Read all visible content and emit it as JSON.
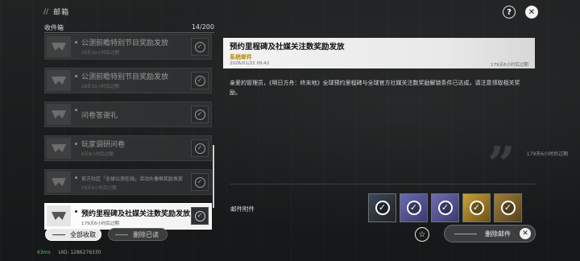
{
  "header": {
    "bars": "//",
    "title": "邮箱"
  },
  "top_icons": {
    "help": "?",
    "close": "✕"
  },
  "inbox": {
    "title": "收件箱",
    "count": "14/200"
  },
  "mails": [
    {
      "title": "公测前瞻特别节目奖励发放",
      "sub": "29天10小时后过期",
      "small": false,
      "dim": true
    },
    {
      "title": "公测前瞻特别节目奖励发放",
      "sub": "29天10小时后过期",
      "small": false,
      "dim": true
    },
    {
      "title": "问卷答谢礼",
      "sub": "",
      "small": false,
      "dim": true
    },
    {
      "title": "玩家调研问卷",
      "sub": "6天9小时后过期",
      "small": false,
      "dim": true
    },
    {
      "title": "官方社区「全球公测在线」活动头像框奖励发放",
      "sub": "29天6小时后过期",
      "small": true,
      "dim": true
    },
    {
      "title": "预约里程碑及社媒关注数奖励发放",
      "sub": "179天6小时后过期",
      "small": false,
      "dim": false,
      "active": true
    }
  ],
  "buttons": {
    "collect_all": "全部收取",
    "delete_read": "删除已读",
    "delete_mail": "删除邮件"
  },
  "detail": {
    "title": "预约里程碑及社媒关注数奖励发放",
    "category": "系统邮件",
    "date": "2026/01/22 09:42",
    "expire": "179天6小时后过期",
    "body": "亲爱的管理员，《明日方舟：终末地》全球预约里程碑与全球官方社媒关注数奖励解锁条件已达成，请注意领取相关奖励。",
    "expire2": "179天6小时后过期",
    "attachments_label": "邮件附件"
  },
  "rewards": [
    {
      "icon": "check-icon"
    },
    {
      "icon": "check-icon"
    },
    {
      "icon": "check-icon"
    },
    {
      "icon": "check-icon"
    },
    {
      "icon": "check-icon"
    }
  ],
  "footer": {
    "ping": "63ms",
    "uid": "UID: 1286276330"
  },
  "colors": {
    "category": "#b08a00",
    "ping": "#58c06a",
    "active_item": "#ffffff"
  }
}
